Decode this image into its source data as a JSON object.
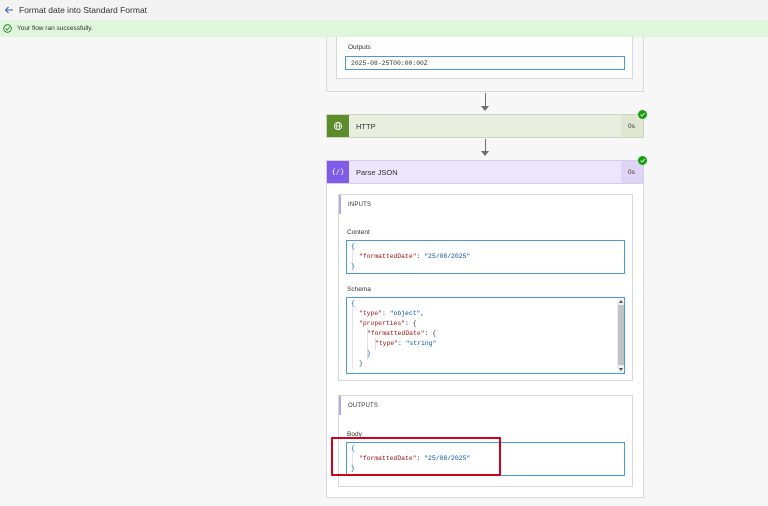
{
  "header": {
    "title": "Format date into Standard Format"
  },
  "banner": {
    "message": "Your flow ran successfully."
  },
  "compose": {
    "outputs_label": "Outputs",
    "outputs_value": "2025-08-25T00:00:00Z"
  },
  "http": {
    "name": "HTTP",
    "duration": "0s"
  },
  "parse_json": {
    "name": "Parse JSON",
    "duration": "0s",
    "inputs_title": "INPUTS",
    "content_label": "Content",
    "content_lines": {
      "l1": "{",
      "key": "\"formattedDate\"",
      "colon": ": ",
      "val": "\"25/08/2025\"",
      "l3": "}"
    },
    "schema_label": "Schema",
    "schema_lines": {
      "open": "{",
      "type_key": "\"type\"",
      "type_val": "\"object\"",
      "props_key": "\"properties\"",
      "props_open": ": {",
      "fd_key": "\"formattedDate\"",
      "fd_open": ": {",
      "inner_type_key": "\"type\"",
      "inner_type_val": "\"string\"",
      "close_inner": "}",
      "close_props": "}",
      "comma": ",",
      "colon": ": "
    },
    "outputs_title": "OUTPUTS",
    "body_label": "Body",
    "body_lines": {
      "l1": "{",
      "key": "\"formattedDate\"",
      "colon": ": ",
      "val": "\"25/08/2025\"",
      "l3": "}"
    }
  },
  "colors": {
    "http_accent": "#5e8b2c",
    "http_header_bg": "#e8efe0",
    "parse_accent": "#7e5ce8",
    "parse_header_bg": "#ebe6fb",
    "success": "#13a10e",
    "highlight": "#d0021b"
  },
  "icons": {
    "back": "arrow-left-icon",
    "success": "check-circle-icon",
    "http": "globe-icon",
    "parse": "curly-braces-icon"
  }
}
